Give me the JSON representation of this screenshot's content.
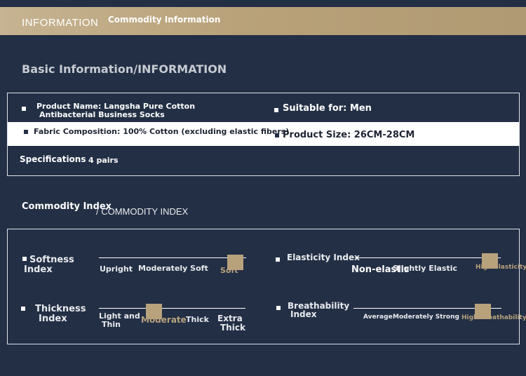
{
  "header": {
    "title": "INFORMATION",
    "subtitle": "Commodity Information"
  },
  "basic": {
    "heading": "Basic Information/INFORMATION",
    "product_name_line1": "Product Name: Langsha Pure Cotton",
    "product_name_line2": "Antibacterial Business Socks",
    "suitable_for": "Suitable for: Men",
    "fabric": "Fabric Composition: 100% Cotton (excluding elastic fibers)",
    "size": "Product Size: 26CM-28CM",
    "spec_label": "Specifications",
    "spec_value": "4 pairs"
  },
  "index": {
    "heading": "Commodity Index",
    "heading_en": "/ COMMODITY INDEX",
    "softness": {
      "title_line1": "Softness",
      "title_line2": "Index",
      "options": [
        "Upright",
        "Moderately Soft",
        "Soft"
      ],
      "selected": 2
    },
    "elasticity": {
      "title": "Elasticity Index",
      "options": [
        "Non-elastic",
        "Slightly Elastic",
        "High elasticity"
      ],
      "selected": 2
    },
    "thickness": {
      "title_line1": "Thickness",
      "title_line2": "Index",
      "options_a_line1": "Light and",
      "options_a_line2": "Thin",
      "option_b": "Moderate",
      "option_c": "Thick",
      "option_d_line1": "Extra",
      "option_d_line2": "Thick",
      "selected": 1
    },
    "breathability": {
      "title_line1": "Breathability",
      "title_line2": "Index",
      "options": [
        "Average",
        "Moderately Strong",
        "High Breathability"
      ],
      "selected": 2
    }
  }
}
